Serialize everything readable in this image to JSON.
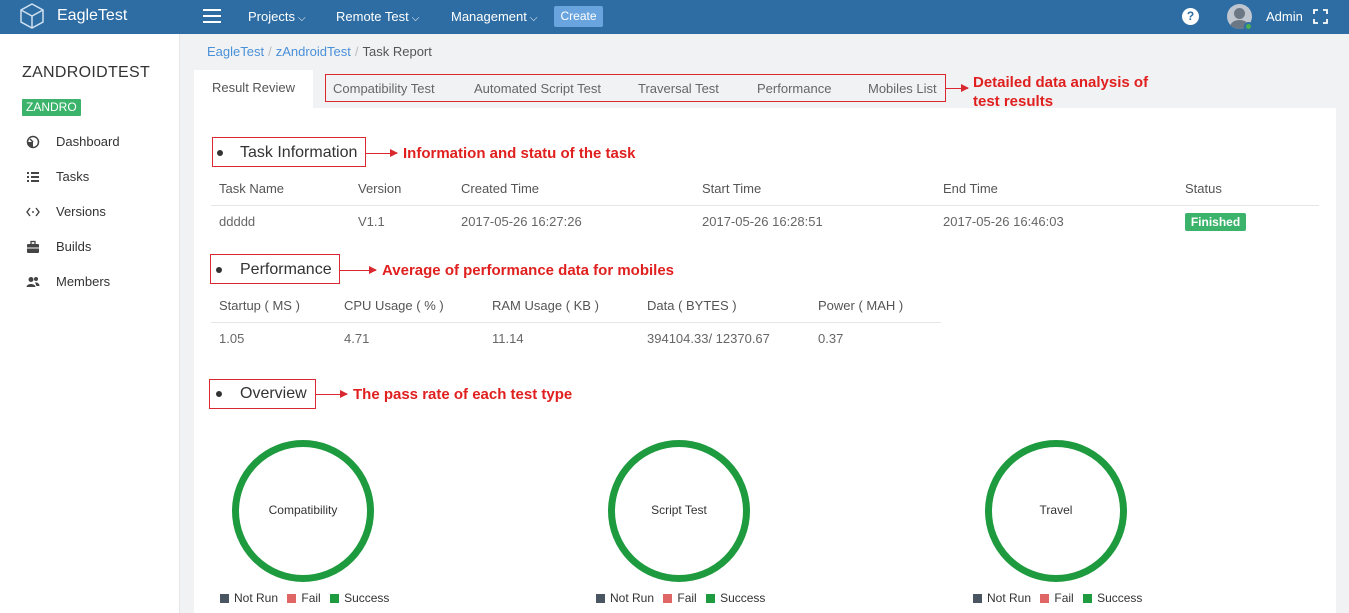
{
  "app": {
    "brand": "EagleTest"
  },
  "topnav": {
    "projects": "Projects",
    "remote_test": "Remote Test",
    "management": "Management",
    "create": "Create",
    "help": "?",
    "user": "Admin"
  },
  "sidebar": {
    "project_title": "ZANDROIDTEST",
    "project_badge": "ZANDRO",
    "items": [
      {
        "label": "Dashboard",
        "icon": "dashboard-icon"
      },
      {
        "label": "Tasks",
        "icon": "list-icon"
      },
      {
        "label": "Versions",
        "icon": "code-icon"
      },
      {
        "label": "Builds",
        "icon": "briefcase-icon"
      },
      {
        "label": "Members",
        "icon": "users-icon"
      }
    ]
  },
  "breadcrumb": [
    "EagleTest",
    "zAndroidTest",
    "Task Report"
  ],
  "tabs": {
    "active": "Result Review",
    "items": [
      "Compatibility Test",
      "Automated Script Test",
      "Traversal Test",
      "Performance",
      "Mobiles List"
    ]
  },
  "annotations": {
    "tabs_line1": "Detailed data analysis of",
    "tabs_line2": "test results",
    "task": "Information and statu of  the task",
    "performance": "Average of performance data for mobiles",
    "overview": "The pass rate of each test type"
  },
  "task_info": {
    "title": "Task Information",
    "headers": [
      "Task Name",
      "Version",
      "Created Time",
      "Start Time",
      "End Time",
      "Status"
    ],
    "row": [
      "ddddd",
      "V1.1",
      "2017-05-26 16:27:26",
      "2017-05-26 16:28:51",
      "2017-05-26 16:46:03",
      "Finished"
    ]
  },
  "performance": {
    "title": "Performance",
    "headers": [
      "Startup ( MS )",
      "CPU Usage ( % )",
      "RAM Usage ( KB )",
      "Data ( BYTES )",
      "Power ( MAH )"
    ],
    "row": [
      "1.05",
      "4.71",
      "11.14",
      "394104.33/ 12370.67",
      "0.37"
    ]
  },
  "overview": {
    "title": "Overview",
    "charts": [
      {
        "label": "Compatibility"
      },
      {
        "label": "Script Test"
      },
      {
        "label": "Travel"
      }
    ],
    "legend": [
      "Not Run",
      "Fail",
      "Success"
    ],
    "colors": {
      "not_run": "#4a5562",
      "fail": "#e06666",
      "success": "#1e9a3f"
    }
  }
}
